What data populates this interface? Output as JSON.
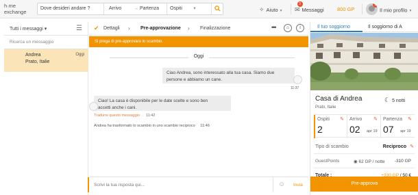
{
  "topbar": {
    "logo_line1": "h·me",
    "logo_line2": "exchange",
    "search": {
      "destination_placeholder": "Dove desideri andare ?",
      "arrival": "Arrivo",
      "departure": "Partenza",
      "guests": "Ospiti"
    },
    "help_label": "Aiuto",
    "messages_label": "Messaggi",
    "messages_badge": "3",
    "gp_label": "800 GP",
    "profile_label": "Il mio profilo",
    "profile_badge": "5"
  },
  "sidebar": {
    "filter_label": "Tutti i messaggi",
    "search_placeholder": "Ricerca un messaggio",
    "conversations": [
      {
        "name": "Andrea",
        "location": "Prato, Italie",
        "date": "Oggi"
      }
    ]
  },
  "conversation": {
    "steps": [
      "Dettagli",
      "Pre-approvazione",
      "Finalizzazione"
    ],
    "active_step": "Pre-approvazione",
    "banner": "Si prega di pre-approvare lo scambio.",
    "day_label": "Oggi",
    "messages": [
      {
        "text_line1": "Ciao Andrea, sono interessato alla tua casa. Siamo due",
        "text_line2": "persone e abbiamo un cane.",
        "time": "11:37"
      },
      {
        "text_line1": "Ciao! La casa è disponibile per le date scelte e sono ben",
        "text_line2": "accetti anche i cani.",
        "time": "11:42",
        "translate": "Tradurre questo messaggio"
      }
    ],
    "system_message": "Andrea ha trasformato lo scambio in uno scambio reciproco",
    "system_time": "11:46",
    "composer_placeholder": "Scrivi la tua risposta qui...",
    "send_label": "Invia"
  },
  "details": {
    "tabs": [
      "Il tuo soggiorno",
      "Il soggiorno di A"
    ],
    "house_title": "Casa di Andrea",
    "nights": "5 notti",
    "house_location": "Prato, Italie",
    "guests_label": "Ospiti",
    "guests_value": "2",
    "arrival_label": "Arrivo",
    "arrival_day": "02",
    "arrival_month": "apr 19",
    "departure_label": "Partenza",
    "departure_day": "07",
    "departure_month": "apr 19",
    "exchange_type_label": "Tipo di scambio",
    "exchange_type_value": "Reciproco",
    "guestpoints_label": "GuestPoints",
    "guestpoints_rate": "62 GP / notte",
    "guestpoints_value": "-310 GP",
    "total_label": "Totale :",
    "total_gp": "+330 GP",
    "total_eur": "/ 50 €",
    "approve_label": "Pre-approva"
  },
  "colors": {
    "accent": "#f29400",
    "link": "#2a7fb8",
    "selected_conv": "#fbe4b8",
    "bubble": "#ececec"
  },
  "icons": [
    "check-icon",
    "search-icon",
    "compass-icon",
    "mail-icon",
    "user-icon",
    "list-icon",
    "home-icon",
    "info-icon",
    "moon-icon",
    "pencil-icon",
    "smile-icon",
    "gp-icon"
  ]
}
